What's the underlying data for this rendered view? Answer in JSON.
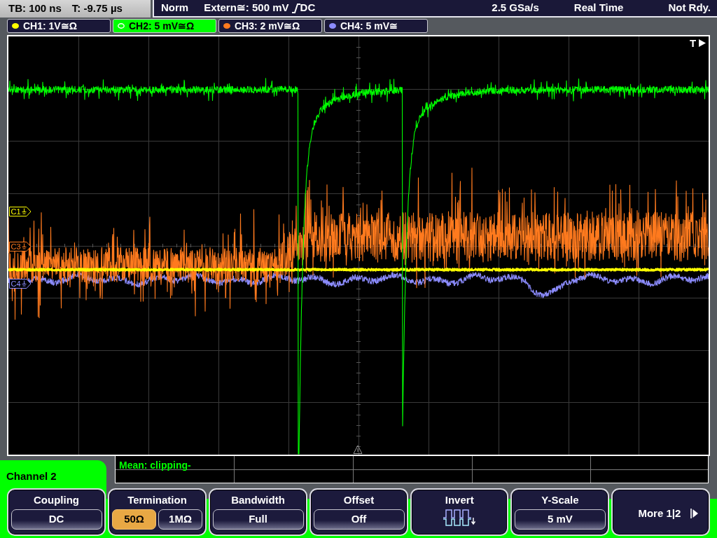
{
  "status_bar": {
    "timebase": "TB: 100 ns",
    "trigger_time": "T: -9.75 µs",
    "trigger_mode": "Norm",
    "trigger_source": "Extern≅: 500 mV",
    "trigger_coupling": "DC",
    "sample_rate": "2.5 GSa/s",
    "acquisition_mode": "Real Time",
    "status": "Not Rdy."
  },
  "channels": [
    {
      "label": "CH1: 1V≅Ω",
      "color": "#ffff00",
      "selected": false
    },
    {
      "label": "CH2: 5 mV≅Ω",
      "color": "#00ff00",
      "selected": true
    },
    {
      "label": "CH3: 2 mV≅Ω",
      "color": "#ff7a1e",
      "selected": false
    },
    {
      "label": "CH4: 5 mV≅",
      "color": "#8c8cff",
      "selected": false
    }
  ],
  "display": {
    "trigger_marker": "T",
    "markers": [
      {
        "label": "C1",
        "color": "#ffff00"
      },
      {
        "label": "C3",
        "color": "#ff7a1e"
      },
      {
        "label": "C4",
        "color": "#8c8cff"
      }
    ]
  },
  "measurements": {
    "cells": [
      "Mean: clipping-"
    ]
  },
  "menu": {
    "title": "Channel 2",
    "softkeys": [
      {
        "kind": "value",
        "title": "Coupling",
        "value": "DC"
      },
      {
        "kind": "options",
        "title": "Termination",
        "options": [
          {
            "label": "50Ω",
            "selected": true
          },
          {
            "label": "1MΩ",
            "selected": false
          }
        ]
      },
      {
        "kind": "value",
        "title": "Bandwidth",
        "value": "Full"
      },
      {
        "kind": "value",
        "title": "Offset",
        "value": "Off"
      },
      {
        "kind": "icon",
        "title": "Invert"
      },
      {
        "kind": "value",
        "title": "Y-Scale",
        "value": "5 mV"
      },
      {
        "kind": "more",
        "label": "More 1|2"
      }
    ]
  }
}
